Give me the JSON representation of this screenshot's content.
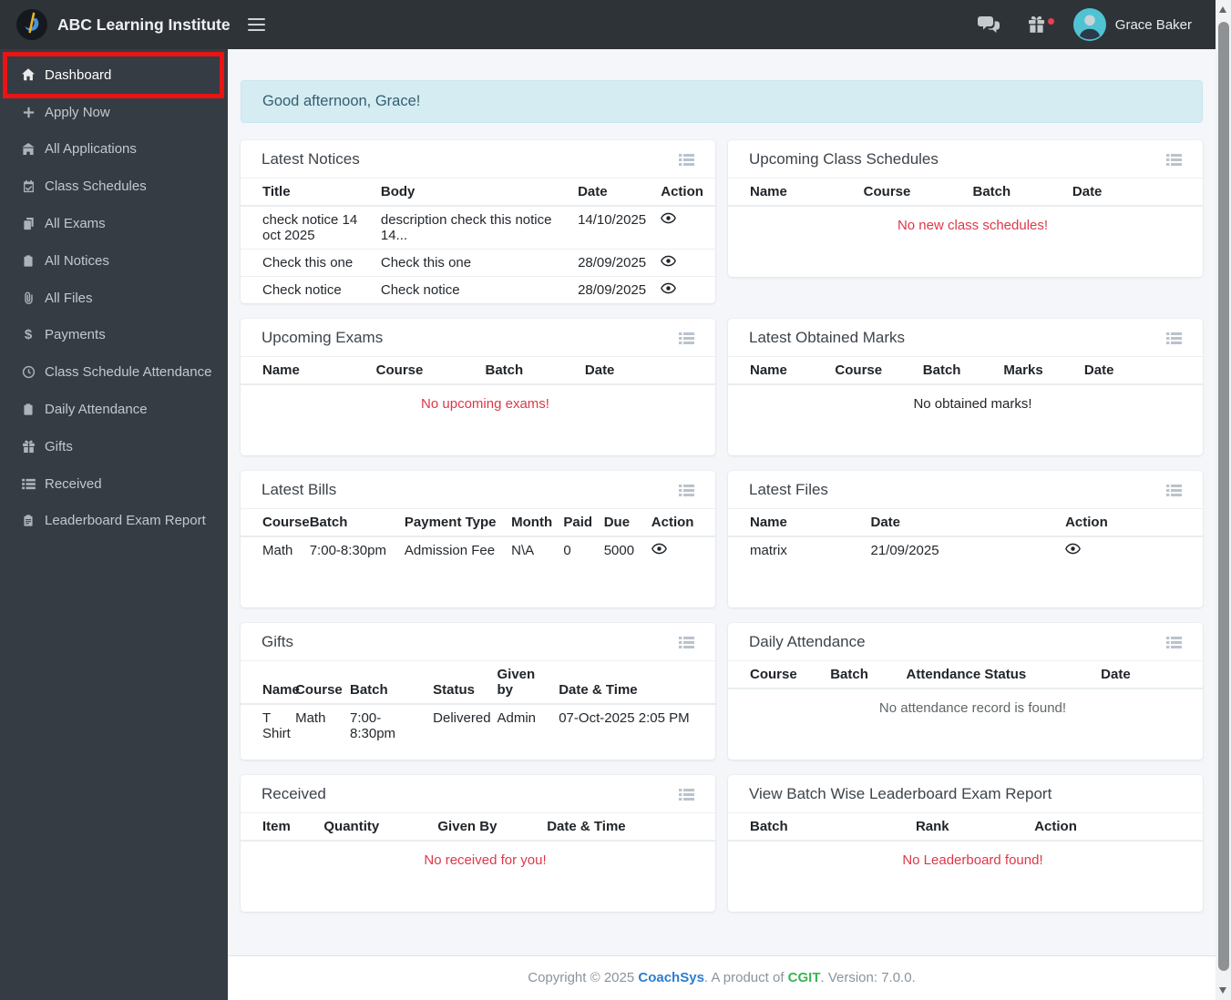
{
  "navbar": {
    "brand": "ABC Learning Institute",
    "user_name": "Grace Baker"
  },
  "sidebar": {
    "items": [
      {
        "label": "Dashboard",
        "icon": "home-icon",
        "active": true,
        "highlighted": true
      },
      {
        "label": "Apply Now",
        "icon": "plus-icon"
      },
      {
        "label": "All Applications",
        "icon": "school-icon"
      },
      {
        "label": "Class Schedules",
        "icon": "calendar-check-icon"
      },
      {
        "label": "All Exams",
        "icon": "copy-icon"
      },
      {
        "label": "All Notices",
        "icon": "clipboard-icon"
      },
      {
        "label": "All Files",
        "icon": "paperclip-icon"
      },
      {
        "label": "Payments",
        "icon": "dollar-icon"
      },
      {
        "label": "Class Schedule Attendance",
        "icon": "clock-icon"
      },
      {
        "label": "Daily Attendance",
        "icon": "clipboard-icon"
      },
      {
        "label": "Gifts",
        "icon": "gift-icon"
      },
      {
        "label": "Received",
        "icon": "list-icon"
      },
      {
        "label": "Leaderboard Exam Report",
        "icon": "clipboard-list-icon"
      }
    ]
  },
  "greeting": {
    "text": "Good afternoon, Grace!"
  },
  "cards": {
    "latest_notices": {
      "title": "Latest Notices",
      "columns": [
        "Title",
        "Body",
        "Date",
        "Action"
      ],
      "rows": [
        [
          "check notice 14 oct 2025",
          "description check this notice 14...",
          "14/10/2025"
        ],
        [
          "Check this one",
          "Check this one",
          "28/09/2025"
        ],
        [
          "Check notice",
          "Check notice",
          "28/09/2025"
        ]
      ]
    },
    "upcoming_class_schedules": {
      "title": "Upcoming Class Schedules",
      "columns": [
        "Name",
        "Course",
        "Batch",
        "Date"
      ],
      "empty": "No new class schedules!"
    },
    "upcoming_exams": {
      "title": "Upcoming Exams",
      "columns": [
        "Name",
        "Course",
        "Batch",
        "Date"
      ],
      "empty": "No upcoming exams!"
    },
    "latest_obtained_marks": {
      "title": "Latest Obtained Marks",
      "columns": [
        "Name",
        "Course",
        "Batch",
        "Marks",
        "Date"
      ],
      "empty": "No obtained marks!"
    },
    "latest_bills": {
      "title": "Latest Bills",
      "columns": [
        "Course",
        "Batch",
        "Payment Type",
        "Month",
        "Paid",
        "Due",
        "Action"
      ],
      "rows": [
        [
          "Math",
          "7:00-8:30pm",
          "Admission Fee",
          "N\\A",
          "0",
          "5000"
        ]
      ]
    },
    "latest_files": {
      "title": "Latest Files",
      "columns": [
        "Name",
        "Date",
        "Action"
      ],
      "rows": [
        [
          "matrix",
          "21/09/2025"
        ]
      ]
    },
    "gifts": {
      "title": "Gifts",
      "columns": [
        "Name",
        "Course",
        "Batch",
        "Status",
        "Given by",
        "Date & Time"
      ],
      "rows": [
        [
          "T Shirt",
          "Math",
          "7:00-8:30pm",
          "Delivered",
          "Admin",
          "07-Oct-2025 2:05 PM"
        ]
      ]
    },
    "daily_attendance": {
      "title": "Daily Attendance",
      "columns": [
        "Course",
        "Batch",
        "Attendance Status",
        "Date"
      ],
      "empty": "No attendance record is found!"
    },
    "received": {
      "title": "Received",
      "columns": [
        "Item",
        "Quantity",
        "Given By",
        "Date & Time"
      ],
      "empty": "No received for you!"
    },
    "leaderboard": {
      "title": "View Batch Wise Leaderboard Exam Report",
      "columns": [
        "Batch",
        "Rank",
        "Action"
      ],
      "empty": "No Leaderboard found!"
    }
  },
  "footer": {
    "copyright_prefix": "Copyright © 2025 ",
    "brand_link": "CoachSys",
    "middle": ". A product of ",
    "company_link": "CGIT",
    "version_suffix": ". Version: 7.0.0."
  },
  "colors": {
    "navbar_bg": "#2e3338",
    "sidebar_bg": "#363c43",
    "highlight_red": "#e91414",
    "banner_bg": "#d5ecf2",
    "banner_text": "#33606f",
    "empty_danger_text": "#dc3848",
    "link_blue": "#2d7dd2",
    "link_green": "#3cb454",
    "avatar_teal": "#4fc3d1",
    "notification_dot": "#e8414f"
  }
}
